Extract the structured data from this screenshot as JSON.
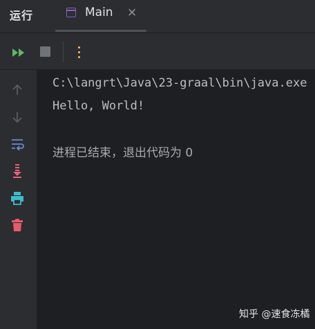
{
  "panel": {
    "title": "运行"
  },
  "tab": {
    "label": "Main",
    "close_glyph": "×",
    "icon": "application-window-icon",
    "icon_color": "#8c5ec2"
  },
  "toolbar": {
    "rerun_icon": "rerun-icon",
    "stop_icon": "stop-icon",
    "more_icon": "more-vertical-icon"
  },
  "gutter": {
    "icons": [
      "arrow-up-icon",
      "arrow-down-icon",
      "soft-wrap-icon",
      "scroll-to-end-icon",
      "print-icon",
      "trash-icon"
    ]
  },
  "console": {
    "command_line": "C:\\langrt\\Java\\23-graal\\bin\\java.exe",
    "output_line": "Hello, World!",
    "exit_line": "进程已结束，退出代码为 0"
  },
  "watermark": {
    "text": "知乎 @速食冻橘"
  },
  "colors": {
    "background": "#2b2d30",
    "console_background": "#1e1f22",
    "rerun_green": "#5fb865",
    "more_yellow": "#f2c55c",
    "wrap_blue": "#6b8bd6",
    "scroll_pink": "#e8607a",
    "print_teal": "#3fbcc8",
    "trash_red": "#e55b6d"
  }
}
